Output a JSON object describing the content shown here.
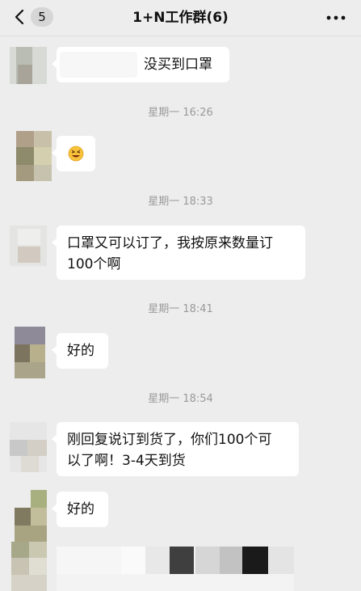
{
  "header": {
    "back_count": "5",
    "title": "1+N工作群(6)"
  },
  "messages": [
    {
      "type": "text",
      "text": "没买到口罩"
    },
    {
      "type": "timestamp",
      "text": "星期一 16:26"
    },
    {
      "type": "emoji",
      "icon": "grinning-squint-face-emoji"
    },
    {
      "type": "timestamp",
      "text": "星期一 18:33"
    },
    {
      "type": "text",
      "line1": "口罩又可以订了，我按原来数量订",
      "line2": "100个啊"
    },
    {
      "type": "timestamp",
      "text": "星期一 18:41"
    },
    {
      "type": "text",
      "text": "好的"
    },
    {
      "type": "timestamp",
      "text": "星期一 18:54"
    },
    {
      "type": "text",
      "line1": "刚回复说订到货了，你们100个可",
      "line2": "以了啊！3-4天到货"
    },
    {
      "type": "text",
      "text": "好的"
    },
    {
      "type": "image",
      "icon": "pixelated-image"
    }
  ],
  "colors": {
    "background": "#ededed",
    "bubble": "#ffffff",
    "timestamp": "#9a9a9a"
  }
}
